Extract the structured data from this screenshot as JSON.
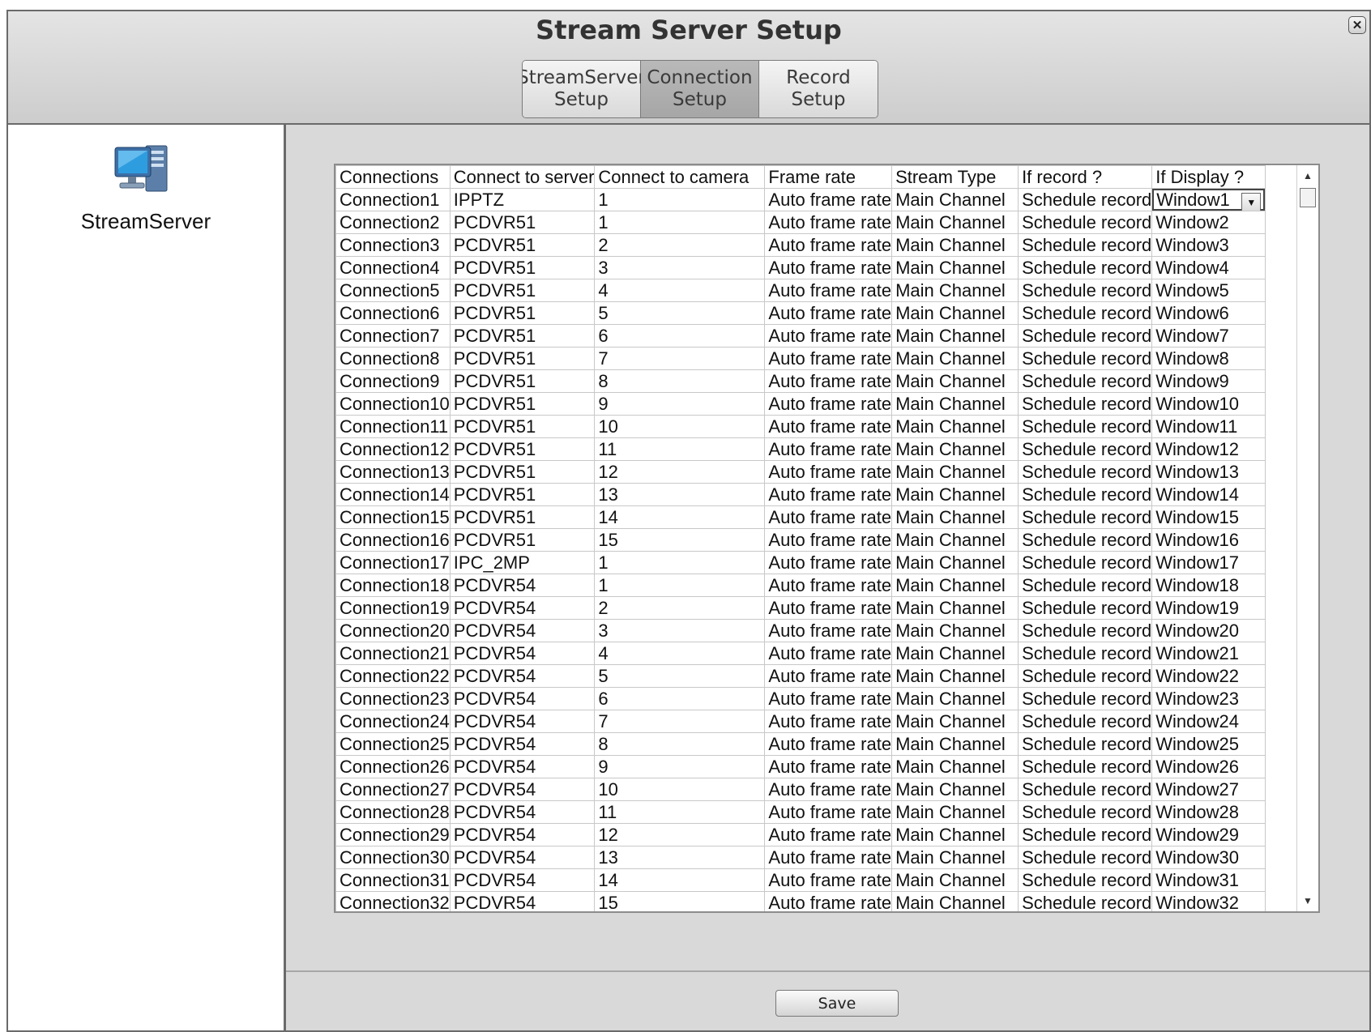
{
  "window": {
    "title": "Stream Server Setup",
    "close_glyph": "✕"
  },
  "tabs": [
    {
      "label": "StreamServer\nSetup",
      "active": false
    },
    {
      "label": "Connection\nSetup",
      "active": true
    },
    {
      "label": "Record\nSetup",
      "active": false
    }
  ],
  "sidebar": {
    "items": [
      {
        "label": "StreamServer",
        "icon": "server-computer-icon"
      }
    ]
  },
  "grid": {
    "columns": [
      "Connections",
      "Connect to server",
      "Connect to camera",
      "Frame rate",
      "Stream Type",
      "If record ?",
      "If Display ?"
    ],
    "dropdown_arrow": "▼",
    "scroll_up": "▲",
    "scroll_down": "▼",
    "rows": [
      [
        "Connection1",
        "IPPTZ",
        "1",
        "Auto frame rate",
        "Main Channel",
        "Schedule record",
        "Window1"
      ],
      [
        "Connection2",
        "PCDVR51",
        "1",
        "Auto frame rate",
        "Main Channel",
        "Schedule record",
        "Window2"
      ],
      [
        "Connection3",
        "PCDVR51",
        "2",
        "Auto frame rate",
        "Main Channel",
        "Schedule record",
        "Window3"
      ],
      [
        "Connection4",
        "PCDVR51",
        "3",
        "Auto frame rate",
        "Main Channel",
        "Schedule record",
        "Window4"
      ],
      [
        "Connection5",
        "PCDVR51",
        "4",
        "Auto frame rate",
        "Main Channel",
        "Schedule record",
        "Window5"
      ],
      [
        "Connection6",
        "PCDVR51",
        "5",
        "Auto frame rate",
        "Main Channel",
        "Schedule record",
        "Window6"
      ],
      [
        "Connection7",
        "PCDVR51",
        "6",
        "Auto frame rate",
        "Main Channel",
        "Schedule record",
        "Window7"
      ],
      [
        "Connection8",
        "PCDVR51",
        "7",
        "Auto frame rate",
        "Main Channel",
        "Schedule record",
        "Window8"
      ],
      [
        "Connection9",
        "PCDVR51",
        "8",
        "Auto frame rate",
        "Main Channel",
        "Schedule record",
        "Window9"
      ],
      [
        "Connection10",
        "PCDVR51",
        "9",
        "Auto frame rate",
        "Main Channel",
        "Schedule record",
        "Window10"
      ],
      [
        "Connection11",
        "PCDVR51",
        "10",
        "Auto frame rate",
        "Main Channel",
        "Schedule record",
        "Window11"
      ],
      [
        "Connection12",
        "PCDVR51",
        "11",
        "Auto frame rate",
        "Main Channel",
        "Schedule record",
        "Window12"
      ],
      [
        "Connection13",
        "PCDVR51",
        "12",
        "Auto frame rate",
        "Main Channel",
        "Schedule record",
        "Window13"
      ],
      [
        "Connection14",
        "PCDVR51",
        "13",
        "Auto frame rate",
        "Main Channel",
        "Schedule record",
        "Window14"
      ],
      [
        "Connection15",
        "PCDVR51",
        "14",
        "Auto frame rate",
        "Main Channel",
        "Schedule record",
        "Window15"
      ],
      [
        "Connection16",
        "PCDVR51",
        "15",
        "Auto frame rate",
        "Main Channel",
        "Schedule record",
        "Window16"
      ],
      [
        "Connection17",
        "IPC_2MP",
        "1",
        "Auto frame rate",
        "Main Channel",
        "Schedule record",
        "Window17"
      ],
      [
        "Connection18",
        "PCDVR54",
        "1",
        "Auto frame rate",
        "Main Channel",
        "Schedule record",
        "Window18"
      ],
      [
        "Connection19",
        "PCDVR54",
        "2",
        "Auto frame rate",
        "Main Channel",
        "Schedule record",
        "Window19"
      ],
      [
        "Connection20",
        "PCDVR54",
        "3",
        "Auto frame rate",
        "Main Channel",
        "Schedule record",
        "Window20"
      ],
      [
        "Connection21",
        "PCDVR54",
        "4",
        "Auto frame rate",
        "Main Channel",
        "Schedule record",
        "Window21"
      ],
      [
        "Connection22",
        "PCDVR54",
        "5",
        "Auto frame rate",
        "Main Channel",
        "Schedule record",
        "Window22"
      ],
      [
        "Connection23",
        "PCDVR54",
        "6",
        "Auto frame rate",
        "Main Channel",
        "Schedule record",
        "Window23"
      ],
      [
        "Connection24",
        "PCDVR54",
        "7",
        "Auto frame rate",
        "Main Channel",
        "Schedule record",
        "Window24"
      ],
      [
        "Connection25",
        "PCDVR54",
        "8",
        "Auto frame rate",
        "Main Channel",
        "Schedule record",
        "Window25"
      ],
      [
        "Connection26",
        "PCDVR54",
        "9",
        "Auto frame rate",
        "Main Channel",
        "Schedule record",
        "Window26"
      ],
      [
        "Connection27",
        "PCDVR54",
        "10",
        "Auto frame rate",
        "Main Channel",
        "Schedule record",
        "Window27"
      ],
      [
        "Connection28",
        "PCDVR54",
        "11",
        "Auto frame rate",
        "Main Channel",
        "Schedule record",
        "Window28"
      ],
      [
        "Connection29",
        "PCDVR54",
        "12",
        "Auto frame rate",
        "Main Channel",
        "Schedule record",
        "Window29"
      ],
      [
        "Connection30",
        "PCDVR54",
        "13",
        "Auto frame rate",
        "Main Channel",
        "Schedule record",
        "Window30"
      ],
      [
        "Connection31",
        "PCDVR54",
        "14",
        "Auto frame rate",
        "Main Channel",
        "Schedule record",
        "Window31"
      ],
      [
        "Connection32",
        "PCDVR54",
        "15",
        "Auto frame rate",
        "Main Channel",
        "Schedule record",
        "Window32"
      ]
    ]
  },
  "footer": {
    "save_label": "Save"
  }
}
